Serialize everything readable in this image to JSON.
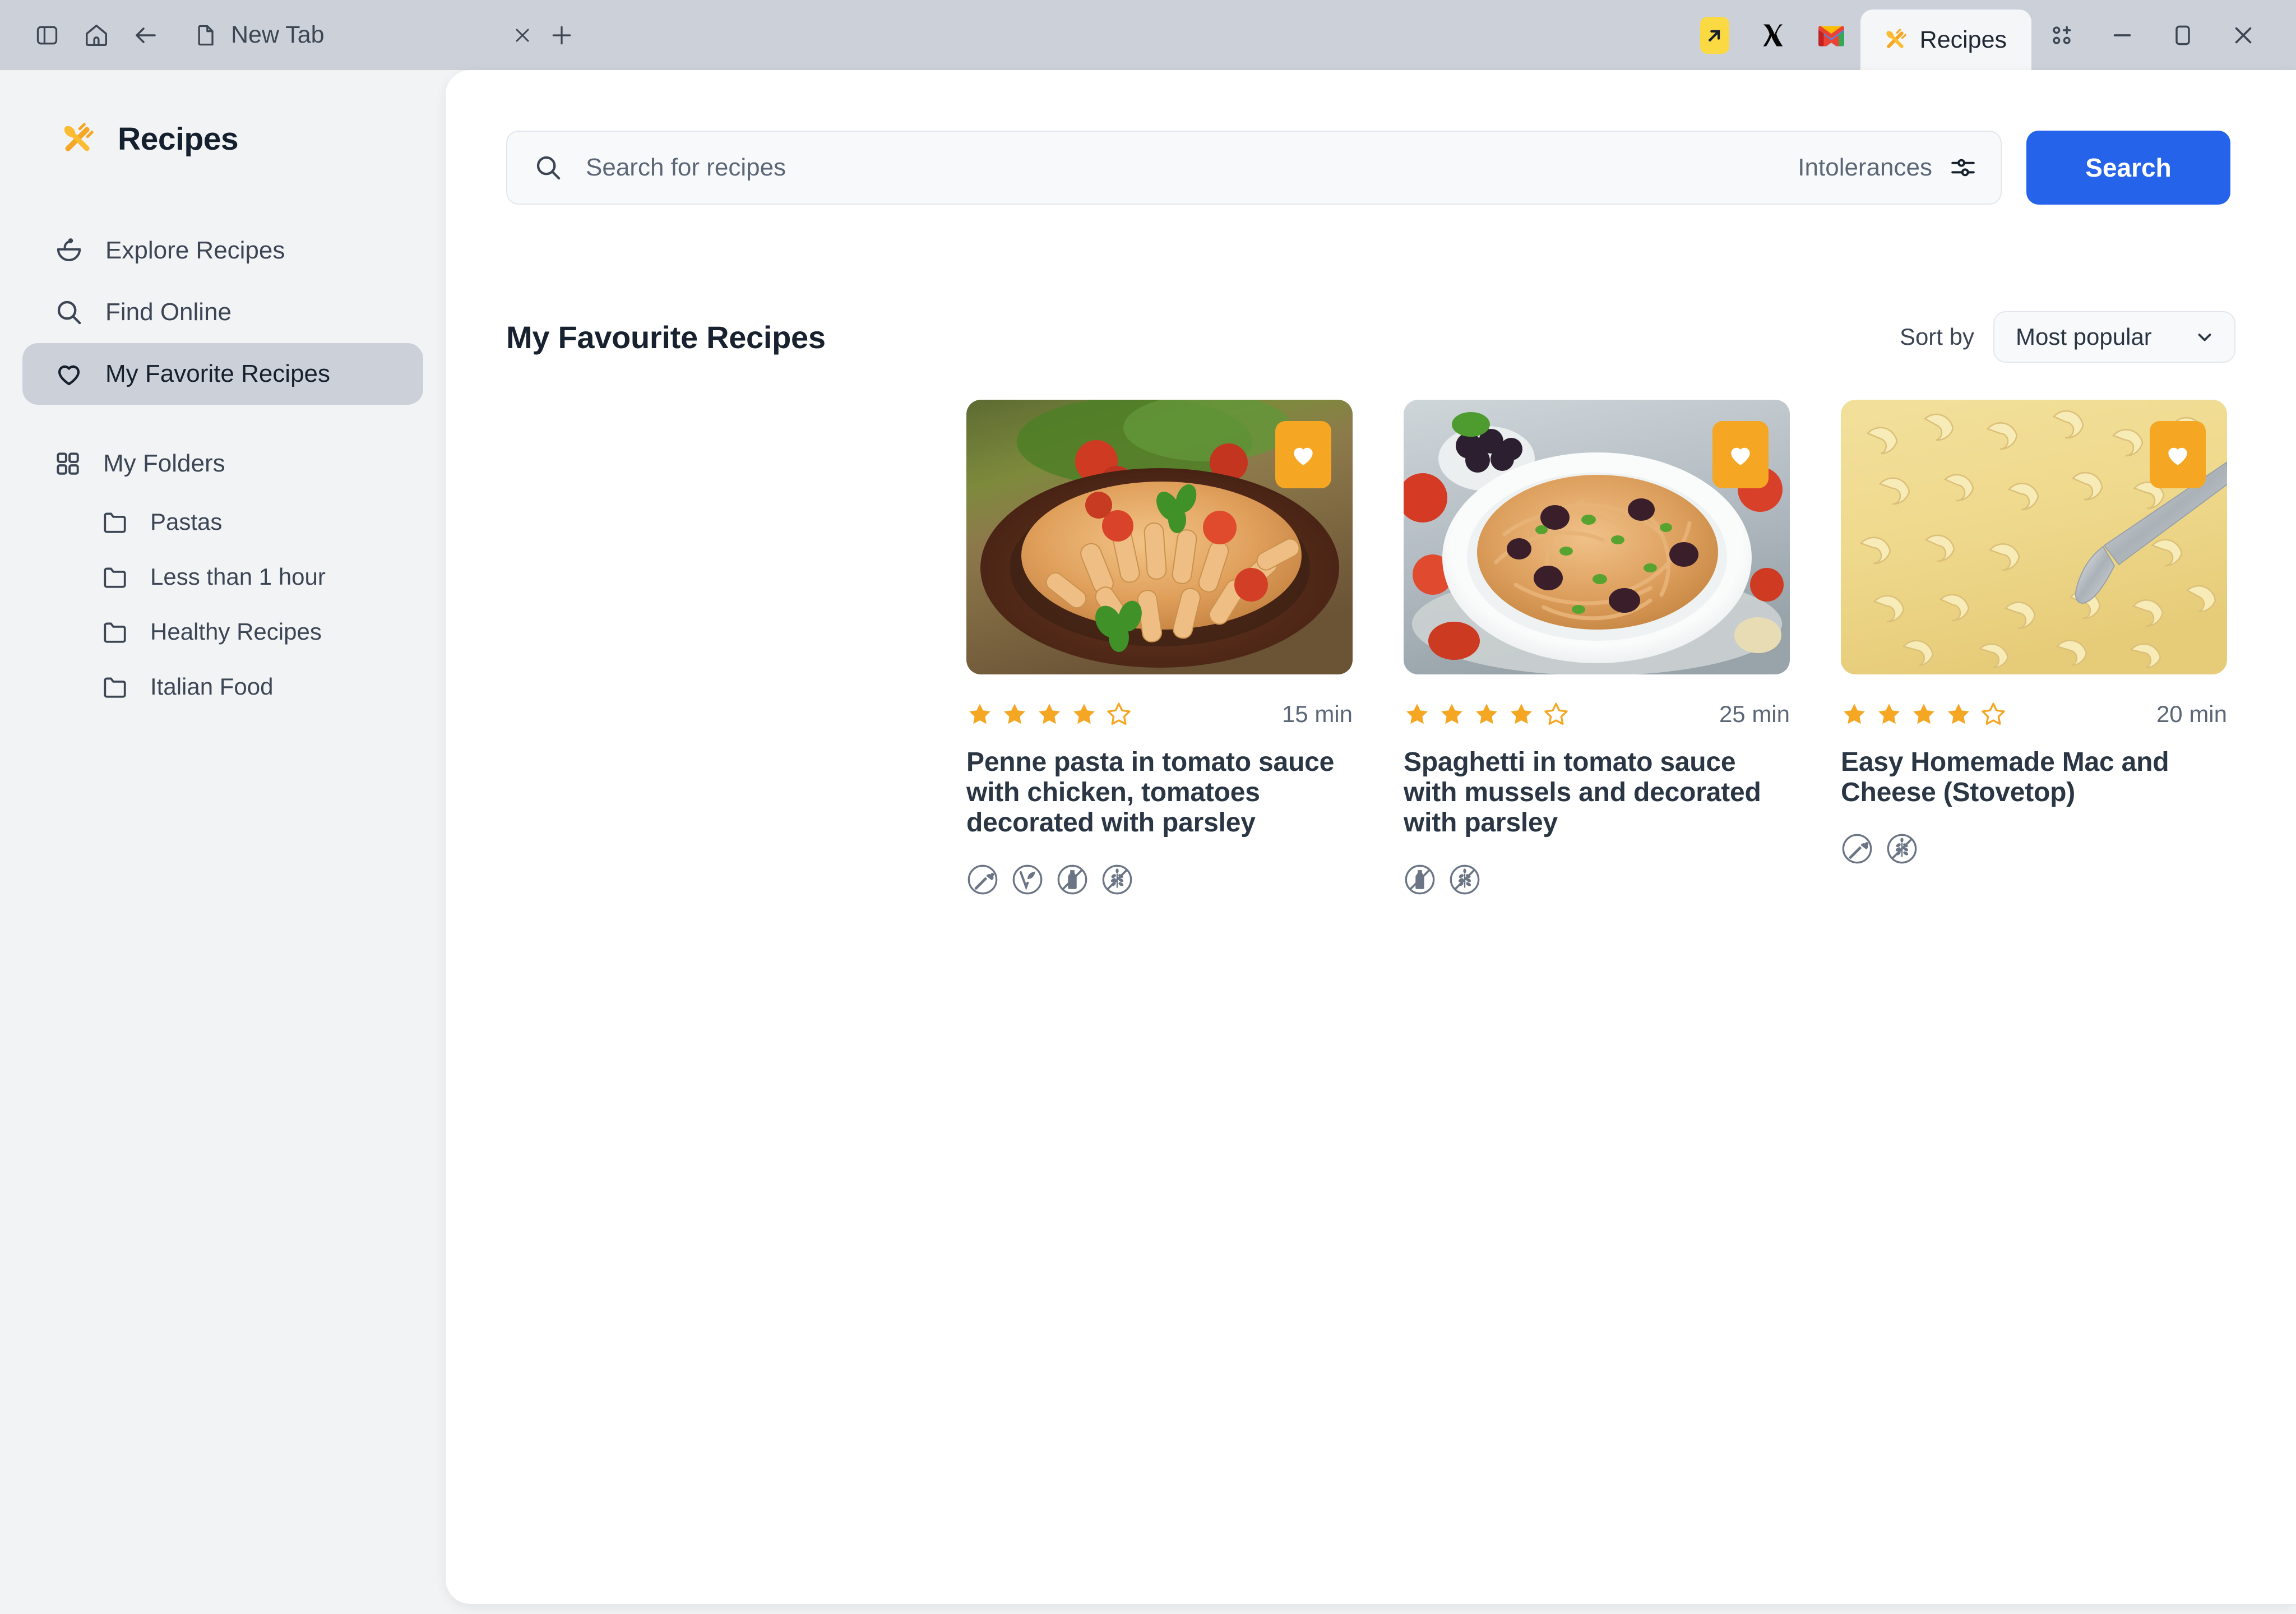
{
  "window": {
    "browser_tab": {
      "label": "New Tab",
      "icon": "document-icon"
    },
    "toolbar_icons": [
      "sidebar-toggle-icon",
      "home-icon",
      "back-arrow-icon"
    ],
    "tab_close_icon": "close-icon",
    "new_tab_icon": "plus-icon",
    "app_icons": [
      "yellow-launcher-icon",
      "x-logo-icon",
      "gmail-icon"
    ],
    "active_tab": {
      "label": "Recipes",
      "icon": "fork-knife-icon"
    },
    "window_controls": [
      "grid-add-icon",
      "minimize-icon",
      "maximize-icon",
      "close-icon"
    ]
  },
  "sidebar": {
    "brand": {
      "title": "Recipes",
      "icon": "fork-knife-icon"
    },
    "items": [
      {
        "label": "Explore Recipes",
        "icon": "bowl-icon",
        "active": false
      },
      {
        "label": "Find Online",
        "icon": "search-icon",
        "active": false
      },
      {
        "label": "My Favorite Recipes",
        "icon": "heart-icon",
        "active": true
      }
    ],
    "folders_header": {
      "label": "My Folders",
      "icon": "grid-icon"
    },
    "folders": [
      {
        "label": "Pastas",
        "icon": "folder-icon"
      },
      {
        "label": "Less than 1 hour",
        "icon": "folder-icon"
      },
      {
        "label": "Healthy Recipes",
        "icon": "folder-icon"
      },
      {
        "label": "Italian Food",
        "icon": "folder-icon"
      }
    ]
  },
  "search": {
    "placeholder": "Search for recipes",
    "value": "",
    "icon": "search-icon",
    "intolerances_label": "Intolerances",
    "intolerances_icon": "sliders-icon",
    "button_label": "Search"
  },
  "main": {
    "section_title": "My Favourite Recipes",
    "sort_label": "Sort by",
    "sort_value": "Most popular",
    "sort_options": [
      "Most popular"
    ],
    "sort_icon": "chevron-down-icon"
  },
  "colors": {
    "accent_blue": "#2563eb",
    "favorite_orange": "#f5a623",
    "star_gold": "#f5a623",
    "text_dark": "#2b3644",
    "text_muted": "#5b6676",
    "panel_bg": "#ffffff",
    "app_bg": "#f2f3f5",
    "titlebar_bg": "#ccd0d9",
    "sidebar_active": "#ccd0d9"
  },
  "recipes": [
    {
      "title": "Penne pasta in tomato sauce with chicken, tomatoes decorated with parsley",
      "rating": 4,
      "rating_max": 5,
      "duration": "15 min",
      "favorite": true,
      "favorite_icon": "heart-filled-icon",
      "image_alt": "penne-pasta-tomato-sauce-photo",
      "tags": [
        {
          "name": "vegetarian",
          "icon": "carrot-icon"
        },
        {
          "name": "vegan",
          "icon": "vegan-leaf-icon"
        },
        {
          "name": "dairy-free",
          "icon": "dairy-free-icon"
        },
        {
          "name": "gluten-free",
          "icon": "gluten-free-icon"
        }
      ]
    },
    {
      "title": "Spaghetti in tomato sauce with mussels and decorated with parsley",
      "rating": 4,
      "rating_max": 5,
      "duration": "25 min",
      "favorite": true,
      "favorite_icon": "heart-filled-icon",
      "image_alt": "spaghetti-olives-tomato-photo",
      "tags": [
        {
          "name": "dairy-free",
          "icon": "dairy-free-icon"
        },
        {
          "name": "gluten-free",
          "icon": "gluten-free-icon"
        }
      ]
    },
    {
      "title": "Easy Homemade Mac and Cheese (Stovetop)",
      "rating": 4,
      "rating_max": 5,
      "duration": "20 min",
      "favorite": true,
      "favorite_icon": "heart-filled-icon",
      "image_alt": "mac-and-cheese-photo",
      "tags": [
        {
          "name": "vegetarian",
          "icon": "carrot-icon"
        },
        {
          "name": "gluten-free",
          "icon": "gluten-free-icon"
        }
      ]
    }
  ]
}
